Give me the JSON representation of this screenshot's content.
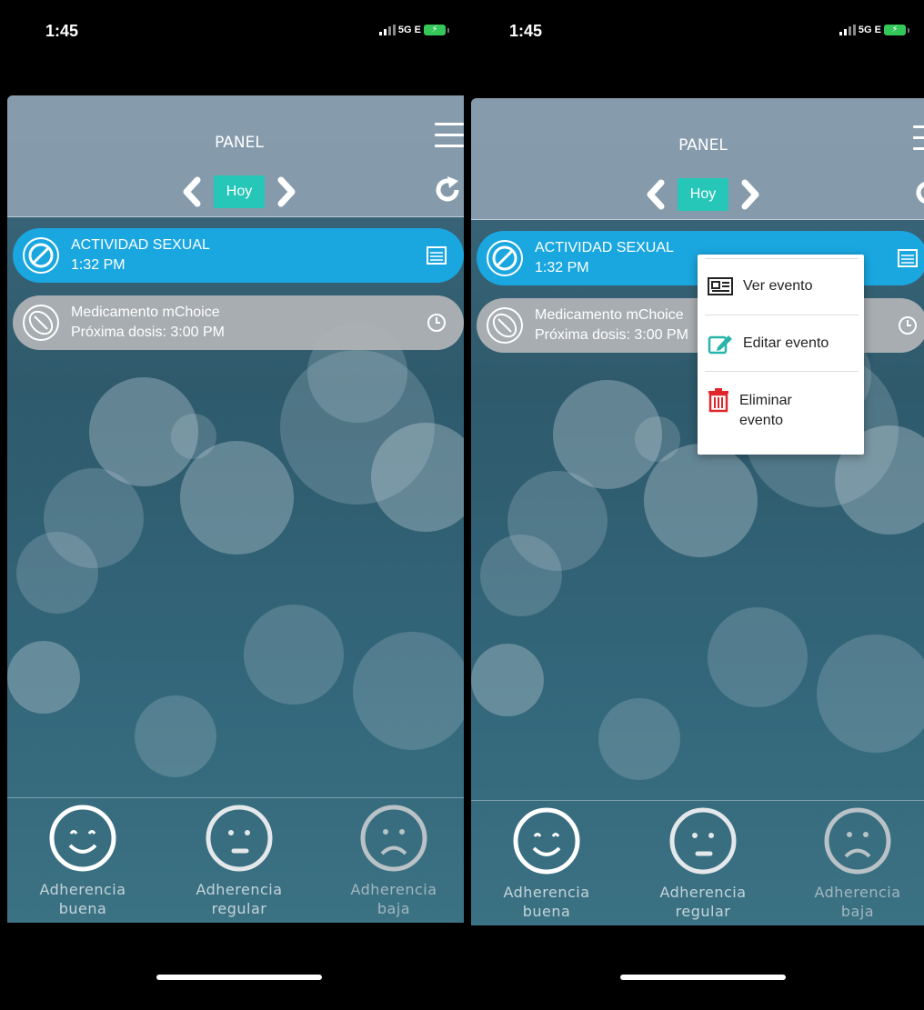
{
  "status": {
    "time": "1:45",
    "network": "5G E"
  },
  "header": {
    "title": "PANEL",
    "date_label": "Hoy"
  },
  "events": [
    {
      "title": "ACTIVIDAD SEXUAL",
      "subtitle": "1:32 PM",
      "color": "#1aa7e0"
    },
    {
      "title": "Medicamento mChoice",
      "subtitle": "Próxima dosis: 3:00 PM",
      "color": "#b2b4b6"
    }
  ],
  "right_events": [
    {
      "title": "ACTIVIDAD SEXUAL",
      "subtitle": "1:32 PM"
    },
    {
      "title": "Medicamento mChoice",
      "subtitle": "Próxima dosis: 3:00 PM"
    }
  ],
  "footer": {
    "good": {
      "line1": "Adherencia",
      "line2": "buena"
    },
    "regular": {
      "line1": "Adherencia",
      "line2": "regular"
    },
    "low": {
      "line1": "Adherencia",
      "line2": "baja"
    }
  },
  "context_menu": {
    "view": "Ver evento",
    "edit": "Editar evento",
    "delete_line1": "Eliminar",
    "delete_line2": "evento"
  },
  "colors": {
    "accent": "#26c6b8",
    "event_blue": "#1aa7e0",
    "delete_red": "#e0262b",
    "edit_teal": "#26b5a8"
  }
}
